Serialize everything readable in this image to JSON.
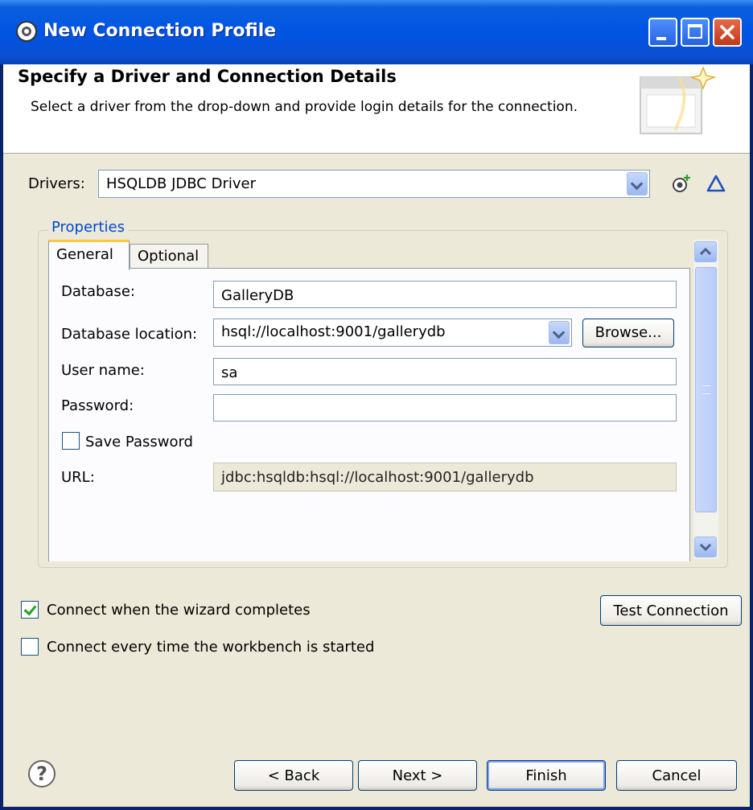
{
  "window": {
    "title": "New Connection Profile",
    "controls": [
      "minimize",
      "maximize",
      "close"
    ]
  },
  "header": {
    "title": "Specify a Driver and Connection Details",
    "description": "Select a driver from the drop-down and provide login details for the connection."
  },
  "drivers": {
    "label": "Drivers:",
    "selected": "HSQLDB JDBC Driver",
    "new_driver_icon": "new-driver-icon",
    "edit_driver_icon": "edit-driver-icon"
  },
  "properties": {
    "group_label": "Properties",
    "tabs": [
      {
        "label": "General",
        "active": true
      },
      {
        "label": "Optional",
        "active": false
      }
    ],
    "fields": {
      "database": {
        "label": "Database:",
        "value": "GalleryDB"
      },
      "database_location": {
        "label": "Database location:",
        "value": "hsql://localhost:9001/gallerydb",
        "browse_label": "Browse..."
      },
      "user_name": {
        "label": "User name:",
        "value": "sa"
      },
      "password": {
        "label": "Password:",
        "value": ""
      },
      "save_password": {
        "label": "Save Password",
        "checked": false
      },
      "url": {
        "label": "URL:",
        "value": "jdbc:hsqldb:hsql://localhost:9001/gallerydb"
      }
    }
  },
  "options": {
    "connect_on_complete": {
      "label": "Connect when the wizard completes",
      "checked": true
    },
    "connect_on_start": {
      "label": "Connect every time the workbench is started",
      "checked": false
    },
    "test_connection_label": "Test Connection"
  },
  "footer": {
    "help_icon": "help-icon",
    "help_glyph": "?",
    "back_label": "< Back",
    "next_label": "Next >",
    "finish_label": "Finish",
    "cancel_label": "Cancel"
  },
  "colors": {
    "title_bar": "#0054e3",
    "group_label": "#0046d5",
    "tab_highlight": "#ffc83c",
    "check_tick": "#21a121"
  }
}
